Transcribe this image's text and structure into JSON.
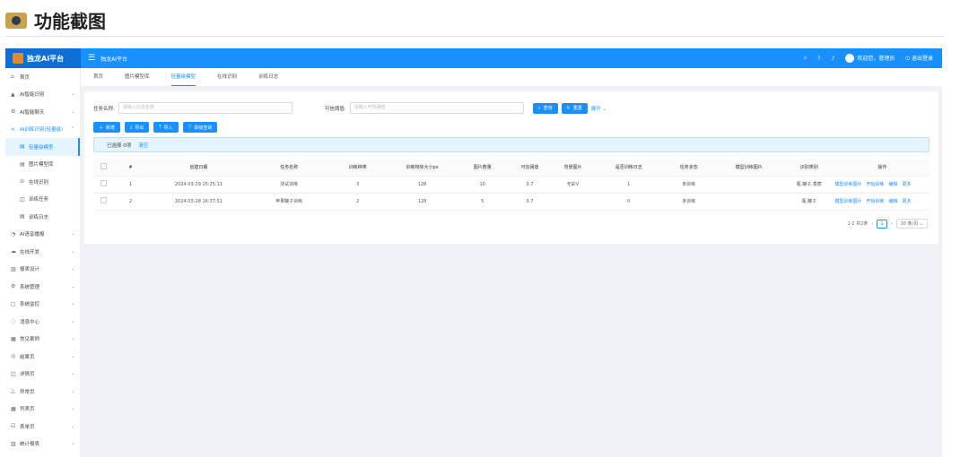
{
  "heading": {
    "title": "功能截图"
  },
  "topbar": {
    "brand": "独龙AI平台",
    "site": "独龙AI平台",
    "user": "欢迎您，管理员",
    "logout": "退出登录"
  },
  "sidebar": {
    "items": [
      {
        "label": "首页",
        "icon": "home-icon",
        "glyph": "⌂",
        "arrow": ""
      },
      {
        "label": "AI智能识别",
        "icon": "warning-icon",
        "glyph": "▲",
        "arrow": "⌄"
      },
      {
        "label": "AI智能聊天",
        "icon": "settings-icon",
        "glyph": "⚙",
        "arrow": "⌄"
      },
      {
        "label": "AI训练识别(轻量级)",
        "icon": "share-icon",
        "glyph": "<",
        "arrow": "⌃"
      },
      {
        "label": "轻量级模型",
        "icon": "file-icon",
        "glyph": "▤",
        "arrow": ""
      },
      {
        "label": "图片模型库",
        "icon": "file-icon",
        "glyph": "▤",
        "arrow": ""
      },
      {
        "label": "在线识别",
        "icon": "link-icon",
        "glyph": "⊝",
        "arrow": ""
      },
      {
        "label": "训练任务",
        "icon": "form-icon",
        "glyph": "◫",
        "arrow": ""
      },
      {
        "label": "训练日志",
        "icon": "log-icon",
        "glyph": "▤",
        "arrow": ""
      },
      {
        "label": "AI语音播报",
        "icon": "voice-icon",
        "glyph": "◔",
        "arrow": "⌄"
      },
      {
        "label": "在线开发",
        "icon": "cloud-icon",
        "glyph": "☁",
        "arrow": "⌄"
      },
      {
        "label": "报表设计",
        "icon": "chart-icon",
        "glyph": "▥",
        "arrow": "⌄"
      },
      {
        "label": "系统管理",
        "icon": "gear-icon",
        "glyph": "⚙",
        "arrow": "⌄"
      },
      {
        "label": "系统监控",
        "icon": "monitor-icon",
        "glyph": "▢",
        "arrow": "⌄"
      },
      {
        "label": "消息中心",
        "icon": "message-icon",
        "glyph": "◌",
        "arrow": "⌄"
      },
      {
        "label": "常见案例",
        "icon": "grid-icon",
        "glyph": "▦",
        "arrow": "⌄"
      },
      {
        "label": "结果页",
        "icon": "check-icon",
        "glyph": "◎",
        "arrow": "⌄"
      },
      {
        "label": "详情页",
        "icon": "detail-icon",
        "glyph": "◫",
        "arrow": "⌄"
      },
      {
        "label": "异常页",
        "icon": "alert-icon",
        "glyph": "△",
        "arrow": "⌄"
      },
      {
        "label": "列表页",
        "icon": "table-icon",
        "glyph": "▦",
        "arrow": "⌄"
      },
      {
        "label": "表单页",
        "icon": "form-icon",
        "glyph": "☑",
        "arrow": "⌄"
      },
      {
        "label": "统计报表",
        "icon": "bar-chart-icon",
        "glyph": "▥",
        "arrow": "⌄"
      }
    ]
  },
  "tabs": [
    "首页",
    "图片模型库",
    "轻量级模型",
    "在线识别",
    "训练日志"
  ],
  "search": {
    "task_label": "任务名称:",
    "task_placeholder": "请输入任务名称",
    "conf_label": "可信阈值:",
    "conf_placeholder": "请输入可信阈值",
    "query": "查询",
    "reset": "重置",
    "expand": "展开"
  },
  "actions": {
    "add": "新增",
    "export": "导出",
    "import": "导入",
    "advanced": "高级查询"
  },
  "alert": {
    "selected": "已选择 0项",
    "clear": "清空"
  },
  "table": {
    "headers": [
      "#",
      "创建日期",
      "任务名称",
      "训练种类",
      "训练物体大小px",
      "图片数量",
      "可信阈值",
      "背景图片",
      "是否训练日志",
      "任务状态",
      "模型训练图片",
      "识别类别",
      "操作"
    ],
    "rows": [
      [
        "1",
        "2024-03-29 15:25:11",
        "测试训练",
        "3",
        "128",
        "10",
        "0.7",
        "无彩V",
        "1",
        "未训练",
        "",
        "瓶,罐子,香蕉"
      ],
      [
        "2",
        "2024-03-28 16:37:51",
        "苹果罐子训练",
        "2",
        "128",
        "5",
        "0.7",
        "",
        "0",
        "未训练",
        "",
        "瓶,罐子"
      ]
    ],
    "ops": [
      "模型训练图片",
      "开始训练",
      "编辑",
      "更多"
    ]
  },
  "pager": {
    "total": "1-2 共2条",
    "page": "1",
    "size": "10 条/页"
  }
}
